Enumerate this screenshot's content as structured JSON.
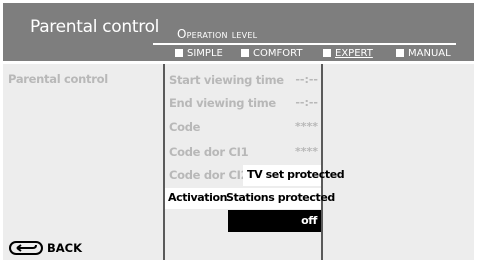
{
  "header": {
    "title": "Parental control",
    "operation_level_label": "Operation level",
    "levels": [
      {
        "label": "SIMPLE",
        "active": false
      },
      {
        "label": "COMFORT",
        "active": false
      },
      {
        "label": "EXPERT",
        "active": true
      },
      {
        "label": "MANUAL",
        "active": false
      }
    ]
  },
  "left_column": {
    "heading": "Parental control"
  },
  "settings": [
    {
      "label": "Start viewing time",
      "value": "--:--"
    },
    {
      "label": "End viewing time",
      "value": "--:--"
    },
    {
      "label": "Code",
      "value": "****"
    },
    {
      "label": "Code dor CI1",
      "value": "****"
    },
    {
      "label": "Code dor CI2",
      "value": ""
    },
    {
      "label": "Activation",
      "value": ""
    }
  ],
  "popup_options": [
    {
      "label": "TV set protected",
      "selected": false
    },
    {
      "label": "Stations protected",
      "selected": false
    },
    {
      "label": "off",
      "selected": true
    }
  ],
  "footer": {
    "back_label": "BACK",
    "back_icon": "back-return-icon"
  },
  "colors": {
    "header_bg": "#7e7e7e",
    "panel_bg": "#ededed",
    "dim_text": "#b8b8b8",
    "divider": "#5a5a5a",
    "highlight_bg": "#000000"
  }
}
